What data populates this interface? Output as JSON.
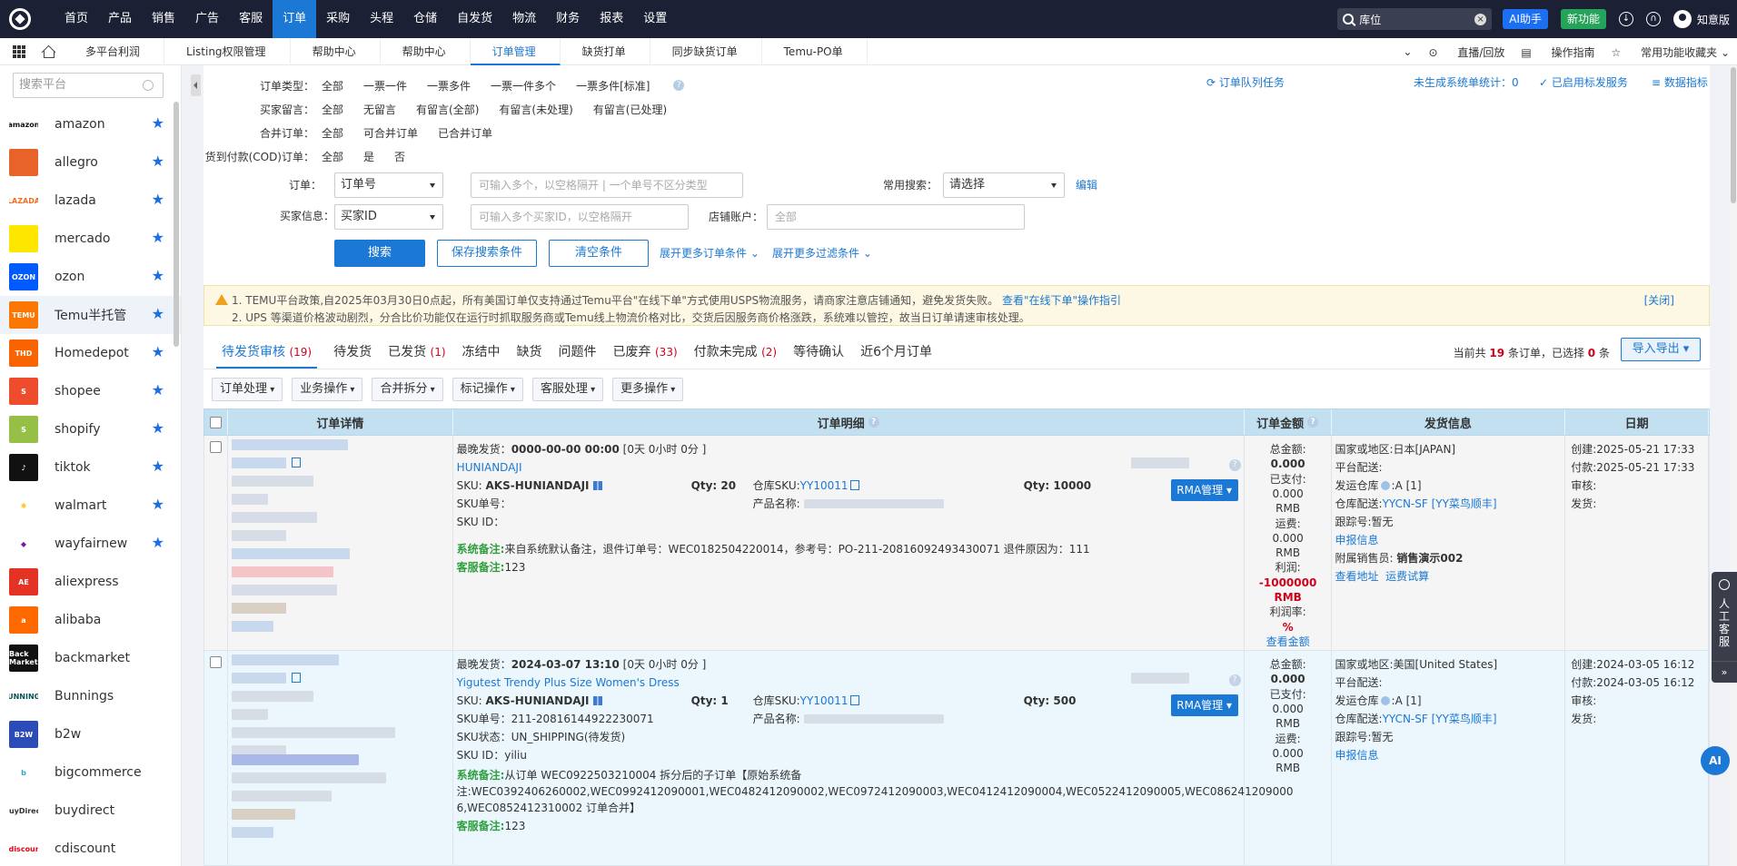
{
  "topnav": {
    "items": [
      "首页",
      "产品",
      "销售",
      "广告",
      "客服",
      "订单",
      "采购",
      "头程",
      "仓储",
      "自发货",
      "物流",
      "财务",
      "报表",
      "设置"
    ],
    "active_index": 5,
    "search_value": "库位",
    "ai_label": "AI助手",
    "new_label": "新功能",
    "username": "知意版"
  },
  "tabbar": {
    "tabs": [
      "多平台利润",
      "Listing权限管理",
      "帮助中心",
      "帮助中心",
      "订单管理",
      "缺货打单",
      "同步缺货订单",
      "Temu-PO单"
    ],
    "active_index": 4,
    "right": [
      "直播/回放",
      "操作指南",
      "常用功能收藏夹"
    ]
  },
  "sidebar": {
    "search_placeholder": "搜索平台",
    "items": [
      {
        "name": "amazon",
        "logo": "amazon",
        "color": "#ffffff",
        "fg": "#111"
      },
      {
        "name": "allegro",
        "logo": "",
        "color": "#e8632a",
        "fg": "#fff"
      },
      {
        "name": "lazada",
        "logo": "LAZADA",
        "color": "#ffffff",
        "fg": "#f36d21"
      },
      {
        "name": "mercado",
        "logo": "",
        "color": "#ffe600",
        "fg": "#2d3277"
      },
      {
        "name": "ozon",
        "logo": "OZON",
        "color": "#005bff",
        "fg": "#fff"
      },
      {
        "name": "Temu半托管",
        "logo": "TEMU",
        "color": "#fb7701",
        "fg": "#fff"
      },
      {
        "name": "Homedepot",
        "logo": "THD",
        "color": "#f96302",
        "fg": "#fff"
      },
      {
        "name": "shopee",
        "logo": "S",
        "color": "#ee4d2d",
        "fg": "#fff"
      },
      {
        "name": "shopify",
        "logo": "S",
        "color": "#95bf47",
        "fg": "#fff"
      },
      {
        "name": "tiktok",
        "logo": "♪",
        "color": "#111111",
        "fg": "#fff"
      },
      {
        "name": "walmart",
        "logo": "✱",
        "color": "#ffffff",
        "fg": "#ffc220"
      },
      {
        "name": "wayfairnew",
        "logo": "◆",
        "color": "#ffffff",
        "fg": "#7b189f"
      },
      {
        "name": "aliexpress",
        "logo": "AE",
        "color": "#e43225",
        "fg": "#fff"
      },
      {
        "name": "alibaba",
        "logo": "a",
        "color": "#ff6a00",
        "fg": "#fff"
      },
      {
        "name": "backmarket",
        "logo": "Back Market",
        "color": "#111111",
        "fg": "#fff"
      },
      {
        "name": "Bunnings",
        "logo": "BUNNINGS",
        "color": "#ffffff",
        "fg": "#0d5257"
      },
      {
        "name": "b2w",
        "logo": "B2W",
        "color": "#2b4bb7",
        "fg": "#fff"
      },
      {
        "name": "bigcommerce",
        "logo": "b",
        "color": "#ffffff",
        "fg": "#34a9c4"
      },
      {
        "name": "buydirect",
        "logo": "BuyDirect",
        "color": "#ffffff",
        "fg": "#333"
      },
      {
        "name": "cdiscount",
        "logo": "Cdiscount",
        "color": "#ffffff",
        "fg": "#e30613"
      }
    ],
    "starred_count": 12,
    "active_index": 5
  },
  "filters": {
    "order_type": {
      "label": "订单类型：",
      "options": [
        "全部",
        "一票一件",
        "一票多件",
        "一票一件多个",
        "一票多件[标准]"
      ]
    },
    "buyer_msg": {
      "label": "买家留言：",
      "options": [
        "全部",
        "无留言",
        "有留言(全部)",
        "有留言(未处理)",
        "有留言(已处理)"
      ]
    },
    "merge": {
      "label": "合并订单：",
      "options": [
        "全部",
        "可合并订单",
        "已合并订单"
      ]
    },
    "cod": {
      "label": "货到付款(COD)订单：",
      "options": [
        "全部",
        "是",
        "否"
      ]
    },
    "order_label": "订单：",
    "order_select": "订单号",
    "order_placeholder": "可输入多个，以空格隔开 | 一个单号不区分类型",
    "common_label": "常用搜索：",
    "common_select": "请选择",
    "edit_link": "编辑",
    "buyer_label": "买家信息：",
    "buyer_select": "买家ID",
    "buyer_placeholder": "可输入多个买家ID，以空格隔开",
    "shop_label": "店铺账户：",
    "shop_placeholder": "全部",
    "search_btn": "搜索",
    "save_btn": "保存搜索条件",
    "clear_btn": "清空条件",
    "more_order": "展开更多订单条件",
    "more_filter": "展开更多过滤条件",
    "queue_link": "订单队列任务",
    "ungen_link": "未生成系统单统计：0",
    "service_link": "已启用标发服务",
    "metrics_link": "数据指标"
  },
  "notice": {
    "line1": "1. TEMU平台政策,自2025年03月30日0点起，所有美国订单仅支持通过Temu平台\"在线下单\"方式使用USPS物流服务，请商家注意店铺通知，避免发货失败。",
    "line1_link": "查看\"在线下单\"操作指引",
    "line2": "2. UPS 等渠道价格波动剧烈，分合比价功能仅在运行时抓取服务商或Temu线上物流价格对比，交货后因服务商价格涨跌，系统难以管控，故当日订单请速审核处理。",
    "close": "[关闭]"
  },
  "status_tabs": [
    {
      "label": "待发货审核",
      "count": "(19)"
    },
    {
      "label": "待发货",
      "count": ""
    },
    {
      "label": "已发货",
      "count": "(1)"
    },
    {
      "label": "冻结中",
      "count": ""
    },
    {
      "label": "缺货",
      "count": ""
    },
    {
      "label": "问题件",
      "count": ""
    },
    {
      "label": "已废弃",
      "count": "(33)"
    },
    {
      "label": "付款未完成",
      "count": "(2)"
    },
    {
      "label": "等待确认",
      "count": ""
    },
    {
      "label": "近6个月订单",
      "count": ""
    }
  ],
  "count_info": {
    "prefix": "当前共",
    "total": "19",
    "mid": "条订单，已选择",
    "selected": "0",
    "suffix": "条"
  },
  "export_btn": "导入导出",
  "actions": [
    "订单处理",
    "业务操作",
    "合并拆分",
    "标记操作",
    "客服处理",
    "更多操作"
  ],
  "table": {
    "headers": [
      "订单详情",
      "订单明细",
      "订单金额",
      "发货信息",
      "日期"
    ]
  },
  "orders": [
    {
      "latest_ship_label": "最晚发货：",
      "latest_ship": "0000-00-00 00:00",
      "latest_ship_extra": "[0天 0小时 0分 ]",
      "product_title": "HUNIANDAJI",
      "sku": "AKS-HUNIANDAJI",
      "qty": "Qty: 20",
      "wh_sku": "YY10011",
      "wh_qty": "Qty: 10000",
      "sku_no": "SKU单号：",
      "sku_status": "",
      "sku_id": "SKU ID：",
      "product_name_label": "产品名称:",
      "sys_note": "来自系统默认备注，退件订单号：WEC0182504220014，参考号：PO-211-20816092493430071 退件原因为：111",
      "sys_note_2": "",
      "sys_note_3": "",
      "cs_note": "123",
      "rma": "RMA管理",
      "amount": [
        "总金额:",
        "0.000",
        "已支付:",
        "0.000",
        "RMB",
        "运费:",
        "0.000",
        "RMB",
        "利润:",
        "-1000000",
        "RMB",
        "利润率:",
        "%",
        "查看金额"
      ],
      "ship": {
        "country": "国家或地区:日本[JAPAN]",
        "platform": "平台配送:",
        "warehouse": "发运仓库",
        "warehouse_val": ":A [1]",
        "wh_ship_label": "仓库配送:",
        "wh_ship": "YYCN-SF [YY菜鸟顺丰]",
        "track": "跟踪号:暂无",
        "declare": "申报信息",
        "sales_label": "附属销售员: ",
        "sales": "销售演示002",
        "view_addr": "查看地址",
        "freight_calc": "运费试算"
      },
      "dates": [
        "创建:2025-05-21 17:33",
        "付款:2025-05-21 17:33",
        "审核:",
        "发货:"
      ]
    },
    {
      "latest_ship_label": "最晚发货：",
      "latest_ship": "2024-03-07 13:10",
      "latest_ship_extra": "[0天 0小时 0分 ]",
      "product_title": "Yigutest Trendy Plus Size Women's Dress",
      "sku": "AKS-HUNIANDAJI",
      "qty": "Qty: 1",
      "wh_sku": "YY10011",
      "wh_qty": "Qty: 500",
      "sku_no": "SKU单号：211-20816144922230071",
      "sku_status": "SKU状态：UN_SHIPPING(待发货)",
      "sku_id": "SKU ID：yiliu",
      "product_name_label": "产品名称:",
      "sys_note": "从订单 WEC0922503210004 拆分后的子订单【原始系统备",
      "sys_note_2": "注:WEC0392406260002,WEC0992412090001,WEC0482412090002,WEC0972412090003,WEC0412412090004,WEC0522412090005,WEC086241209000",
      "sys_note_3": "6,WEC0852412310002 订单合并】",
      "cs_note": "123",
      "rma": "RMA管理",
      "amount": [
        "总金额:",
        "0.000",
        "已支付:",
        "0.000",
        "RMB",
        "运费:",
        "0.000",
        "RMB"
      ],
      "ship": {
        "country": "国家或地区:美国[United States]",
        "platform": "平台配送:",
        "warehouse": "发运仓库",
        "warehouse_val": ":A [1]",
        "wh_ship_label": "仓库配送:",
        "wh_ship": "YYCN-SF [YY菜鸟顺丰]",
        "track": "跟踪号:暂无",
        "declare": "申报信息"
      },
      "dates": [
        "创建:2024-03-05 16:12",
        "付款:2024-03-05 16:12",
        "审核:",
        "发货:"
      ]
    }
  ],
  "float": {
    "service": "人工客服",
    "ai": "AI"
  }
}
